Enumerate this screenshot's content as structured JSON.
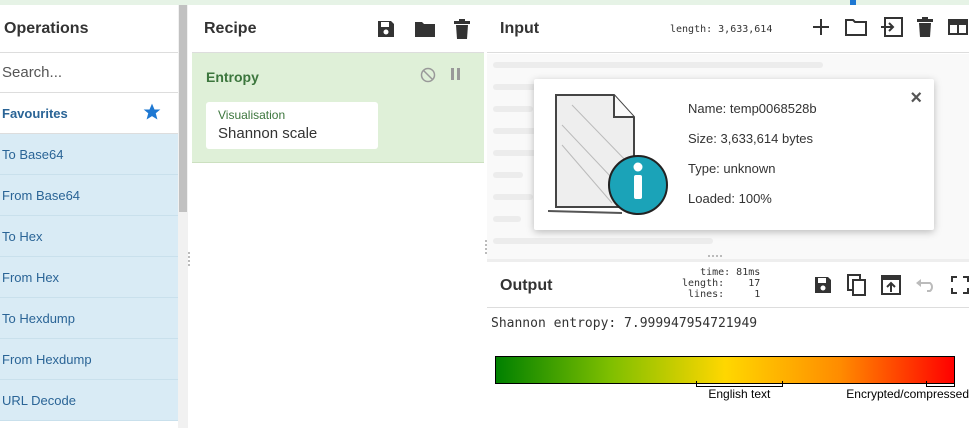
{
  "operations": {
    "title": "Operations",
    "search_placeholder": "Search...",
    "favourites_label": "Favourites",
    "items": [
      "To Base64",
      "From Base64",
      "To Hex",
      "From Hex",
      "To Hexdump",
      "From Hexdump",
      "URL Decode"
    ]
  },
  "recipe": {
    "title": "Recipe",
    "operation": {
      "name": "Entropy",
      "field_label": "Visualisation",
      "field_value": "Shannon scale"
    }
  },
  "input": {
    "title": "Input",
    "length_text": "length: 3,633,614",
    "file": {
      "name": "Name: temp0068528b",
      "size": "Size: 3,633,614 bytes",
      "type": "Type: unknown",
      "loaded": "Loaded: 100%",
      "close": "×"
    }
  },
  "output": {
    "title": "Output",
    "stats": {
      "time": "time: 81ms",
      "length": "length:    17",
      "lines": "lines:     1"
    },
    "text": "Shannon entropy: 7.999947954721949",
    "scale": {
      "left_label": "English text",
      "right_label": "Encrypted/compressed",
      "min": 0,
      "max": 8,
      "english_text_range": [
        3.5,
        5
      ],
      "encrypted_range": [
        7.5,
        8
      ],
      "value": 7.999947954721949
    }
  },
  "colors": {
    "favourites_star": "#1e78d2",
    "recipe_op_bg": "#dff0d8",
    "ops_item_bg": "#d9ebf5",
    "scale_gradient": [
      "#008000",
      "#ffd700",
      "#ff0000"
    ]
  }
}
